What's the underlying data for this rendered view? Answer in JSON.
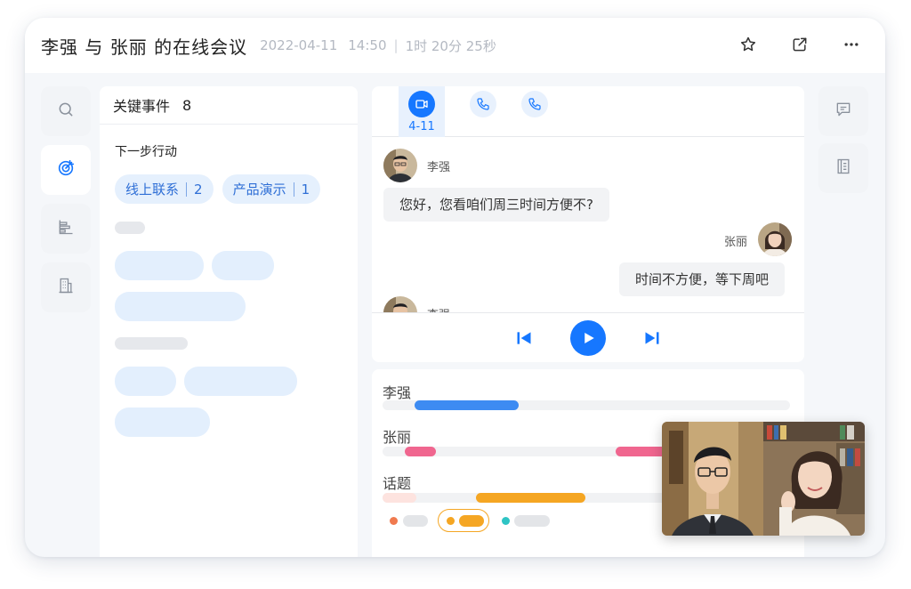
{
  "header": {
    "title": "李强 与  张丽 的在线会议",
    "date": "2022-04-11",
    "time": "14:50",
    "duration": "1时 20分 25秒",
    "icons": [
      "star-icon",
      "share-icon",
      "more-icon"
    ]
  },
  "left_rail": {
    "icons": [
      "search-icon",
      "target-icon",
      "chart-icon",
      "building-icon"
    ],
    "active_index": 1
  },
  "events": {
    "title": "关键事件",
    "count": "8",
    "next_action_title": "下一步行动",
    "chips": [
      {
        "label": "线上联系",
        "count": "2"
      },
      {
        "label": "产品演示",
        "count": "1"
      }
    ]
  },
  "tabs": [
    {
      "icon": "video-icon",
      "label": "4-11",
      "active": true
    },
    {
      "icon": "phone-icon",
      "label": "",
      "active": false
    },
    {
      "icon": "phone-icon",
      "label": "",
      "active": false
    }
  ],
  "messages": [
    {
      "speaker": "李强",
      "text": "您好，您看咱们周三时间方便不?",
      "side": "left"
    },
    {
      "speaker": "张丽",
      "text": "时间不方便，等下周吧",
      "side": "right"
    },
    {
      "speaker": "李强",
      "text": "",
      "side": "left"
    }
  ],
  "player": {
    "icons": [
      "skip-back-icon",
      "play-icon",
      "skip-forward-icon"
    ]
  },
  "timeline": {
    "rows": [
      {
        "label": "李强",
        "color": "#3d8bf2"
      },
      {
        "label": "张丽",
        "color": "#f0668f"
      },
      {
        "label": "话题",
        "color": "#f5a623"
      }
    ],
    "legend_colors": [
      "#f07a4f",
      "#f5a623",
      "#2ec4c4"
    ]
  },
  "right_rail": {
    "icons": [
      "comment-icon",
      "document-icon"
    ]
  },
  "colors": {
    "accent": "#1677ff",
    "chip_bg": "#e5f0fd",
    "panel_bg": "#f5f7fa"
  }
}
